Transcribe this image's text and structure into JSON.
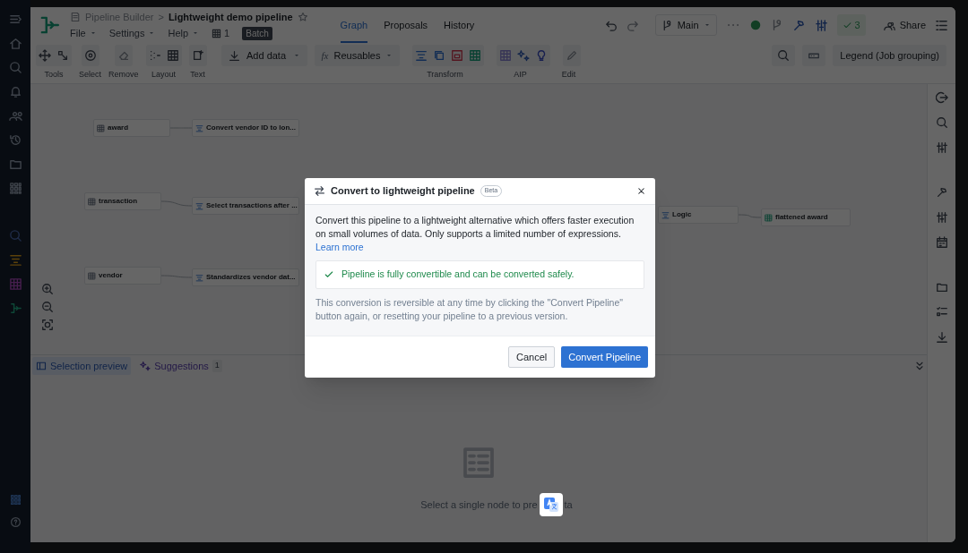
{
  "header": {
    "breadcrumb": "Pipeline Builder",
    "separator": ">",
    "title": "Lightweight demo pipeline",
    "menus": [
      {
        "label": "File"
      },
      {
        "label": "Settings"
      },
      {
        "label": "Help"
      }
    ],
    "count": "1",
    "badge": "Batch"
  },
  "tabs": [
    {
      "label": "Graph",
      "selected": true
    },
    {
      "label": "Proposals",
      "selected": false
    },
    {
      "label": "History",
      "selected": false
    }
  ],
  "actions": {
    "branch": "Main",
    "checks": "3",
    "share": "Share"
  },
  "toolbar": {
    "groups": [
      {
        "label": "Tools"
      },
      {
        "label": "Select"
      },
      {
        "label": "Remove"
      },
      {
        "label": "Layout"
      },
      {
        "label": "Text"
      },
      {
        "label": "Transform"
      },
      {
        "label": "AIP"
      },
      {
        "label": "Edit"
      }
    ],
    "add_data": "Add data",
    "reusables_icon": "fx",
    "reusables": "Reusables",
    "legend": "Legend (Job grouping)"
  },
  "graph": {
    "nodes": [
      {
        "label": "award",
        "kind": "dataset"
      },
      {
        "label": "Convert vendor ID to lon...",
        "kind": "transform"
      },
      {
        "label": "transaction",
        "kind": "dataset"
      },
      {
        "label": "Select transactions after ...",
        "kind": "transform"
      },
      {
        "label": "vendor",
        "kind": "dataset"
      },
      {
        "label": "Standardizes vendor dat...",
        "kind": "transform"
      },
      {
        "label": "Logic",
        "kind": "transform"
      },
      {
        "label": "flattened award",
        "kind": "output"
      }
    ]
  },
  "bottom_panel": {
    "tabs": [
      {
        "label": "Selection preview",
        "selected": true
      },
      {
        "label": "Suggestions",
        "count": "1",
        "selected": false
      }
    ],
    "empty_text": "Select a single node to pre",
    "empty_text_tail": "ta"
  },
  "dialog": {
    "title": "Convert to lightweight pipeline",
    "badge": "Beta",
    "description": "Convert this pipeline to a lightweight alternative which offers faster execution on small volumes of data. Only supports a limited number of expressions.",
    "link": "Learn more",
    "status": "Pipeline is fully convertible and can be converted safely.",
    "note": "This conversion is reversible at any time by clicking the \"Convert Pipeline\" button again, or resetting your pipeline to a previous version.",
    "buttons": [
      {
        "label": "Cancel",
        "kind": "secondary"
      },
      {
        "label": "Convert Pipeline",
        "kind": "primary"
      }
    ]
  }
}
